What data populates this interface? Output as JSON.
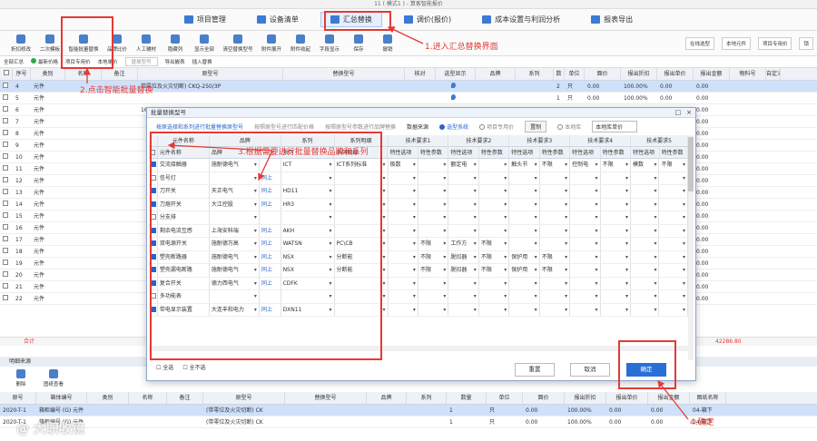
{
  "window": {
    "title": "11 ( 模式1 ) - 算客智能报价"
  },
  "tabs": [
    {
      "label": "项目管理"
    },
    {
      "label": "设备清单"
    },
    {
      "label": "汇总替换"
    },
    {
      "label": "调价(报价)"
    },
    {
      "label": "成本设置与利润分析"
    },
    {
      "label": "报表导出"
    }
  ],
  "toolbar": {
    "items": [
      "折扣修改",
      "二次模板",
      "智能批量替换",
      "品牌比价",
      "人工辅材",
      "隐藏列",
      "显示全部",
      "清空替换型号",
      "附件展开",
      "附件收起",
      "字段显示",
      "保存",
      "撤销"
    ],
    "right": [
      "在线选型",
      "本地元件",
      "项目专用价",
      "锁"
    ]
  },
  "subbar": {
    "items": [
      "全部汇总",
      "最新价格",
      "项目专用价",
      "本地单价",
      "替换型号",
      "导出嵌表",
      "插入替换"
    ]
  },
  "main_grid": {
    "columns": [
      "序号",
      "类别",
      "名称",
      "备注",
      "原型号",
      "替换型号",
      "核对",
      "选型显示",
      "品牌",
      "系列",
      "数",
      "单位",
      "面价",
      "报出折扣",
      "报出单价",
      "报出金额",
      "物料号",
      "自定义"
    ],
    "rows": [
      {
        "no": "4",
        "cat": "元件",
        "orig": "带零位及火灾切断) CKQ-250/3P",
        "qty": "2",
        "unit": "只",
        "price": "0.00",
        "disc": "100.00%",
        "up": "0.00",
        "amt": "0.00"
      },
      {
        "no": "5",
        "cat": "元件",
        "orig": "",
        "qty": "1",
        "unit": "只",
        "price": "0.00",
        "disc": "100.00%",
        "up": "0.00",
        "amt": "0.00"
      },
      {
        "no": "6",
        "cat": "元件",
        "orig": "16A/30mA CKBL-63C/1P+N",
        "qty": "",
        "unit": "",
        "price": "",
        "disc": "",
        "up": "0.00",
        "amt": "0.00"
      },
      {
        "no": "7",
        "cat": "元件",
        "orig": "",
        "qty": "",
        "unit": "",
        "price": "",
        "disc": "",
        "up": "0.00",
        "amt": "0.00"
      },
      {
        "no": "8",
        "cat": "元件",
        "orig": "",
        "qty": "",
        "unit": "",
        "price": "",
        "disc": "",
        "up": "0.00",
        "amt": "0.00"
      },
      {
        "no": "9",
        "cat": "元件",
        "orig": "",
        "qty": "",
        "unit": "",
        "price": "",
        "disc": "",
        "up": "0.00",
        "amt": "0.00"
      },
      {
        "no": "10",
        "cat": "元件",
        "orig": "",
        "qty": "",
        "unit": "",
        "price": "",
        "disc": "",
        "up": "0.00",
        "amt": "0.00"
      },
      {
        "no": "11",
        "cat": "元件",
        "orig": "",
        "qty": "",
        "unit": "",
        "price": "",
        "disc": "",
        "up": "0.00",
        "amt": "0.00"
      },
      {
        "no": "12",
        "cat": "元件",
        "orig": "",
        "qty": "",
        "unit": "",
        "price": "",
        "disc": "",
        "up": "0.00",
        "amt": "0.00"
      },
      {
        "no": "13",
        "cat": "元件",
        "orig": "",
        "qty": "",
        "unit": "",
        "price": "",
        "disc": "",
        "up": "0.00",
        "amt": "0.00"
      },
      {
        "no": "14",
        "cat": "元件",
        "orig": "",
        "qty": "",
        "unit": "",
        "price": "",
        "disc": "",
        "up": "0.00",
        "amt": "0.00"
      },
      {
        "no": "15",
        "cat": "元件",
        "orig": "",
        "qty": "",
        "unit": "",
        "price": "",
        "disc": "",
        "up": "0.00",
        "amt": "0.00"
      },
      {
        "no": "16",
        "cat": "元件",
        "orig": "",
        "qty": "",
        "unit": "",
        "price": "",
        "disc": "",
        "up": "0.00",
        "amt": "0.00"
      },
      {
        "no": "17",
        "cat": "元件",
        "orig": "",
        "qty": "",
        "unit": "",
        "price": "",
        "disc": "",
        "up": "0.00",
        "amt": "0.00"
      },
      {
        "no": "18",
        "cat": "元件",
        "orig": "",
        "qty": "",
        "unit": "",
        "price": "",
        "disc": "",
        "up": "0.00",
        "amt": "0.00"
      },
      {
        "no": "19",
        "cat": "元件",
        "orig": "",
        "qty": "",
        "unit": "",
        "price": "",
        "disc": "",
        "up": "0.00",
        "amt": "0.00"
      },
      {
        "no": "20",
        "cat": "元件",
        "orig": "",
        "qty": "",
        "unit": "",
        "price": "",
        "disc": "",
        "up": "0.00",
        "amt": "0.00"
      },
      {
        "no": "21",
        "cat": "元件",
        "orig": "",
        "qty": "",
        "unit": "",
        "price": "",
        "disc": "",
        "up": "0.00",
        "amt": "0.00"
      },
      {
        "no": "22",
        "cat": "元件",
        "orig": "",
        "qty": "",
        "unit": "",
        "price": "",
        "disc": "",
        "up": "0.00",
        "amt": "0.00"
      }
    ],
    "total_label": "合计",
    "total_value": "42286.80"
  },
  "detail": {
    "title": "明细来源",
    "tools": [
      "删除",
      "图纸查看"
    ],
    "columns": [
      "原号",
      "箱体编号",
      "类别",
      "名称",
      "备注",
      "原型号",
      "替换型号",
      "品牌",
      "系列",
      "数量",
      "单位",
      "面价",
      "报出折扣",
      "报出单价",
      "报出金额",
      "图纸名称"
    ],
    "rows": [
      {
        "no": "2020-T-1",
        "box": "箱柜编号 (G) 元件",
        "orig": "(带零位及火灾切断) CK",
        "qty": "1",
        "unit": "只",
        "price": "0.00",
        "disc": "100.00%",
        "up": "0.00",
        "amt": "0.00",
        "draw": "04-箱下"
      },
      {
        "no": "2020-T-1",
        "box": "箱柜编号 (G) 元件",
        "orig": "(带零位及火灾切断) CK",
        "qty": "1",
        "unit": "只",
        "price": "0.00",
        "disc": "100.00%",
        "up": "0.00",
        "amt": "0.00",
        "draw": "04-箱下"
      }
    ]
  },
  "watermark": "@ 大职收镜",
  "dialog": {
    "title": "批量替换型号",
    "links": [
      "按原选择和系列进行批量替换原型号",
      "按照原型号进行匹配价格",
      "按照原型号参数进行品牌替换"
    ],
    "data_source_label": "数据来源",
    "source_options": [
      "选型系统",
      "项目专用价",
      "本地库"
    ],
    "prefill_button": "置制",
    "local_select": "本地库单价",
    "head1": [
      "元件名称",
      "品牌",
      "系列",
      "系列明细",
      "技术要求1",
      "技术要求2",
      "技术要求3",
      "技术要求4",
      "技术要求5"
    ],
    "head2": [
      "元件名称",
      "品牌",
      "系列",
      "系列明细",
      "特性选项",
      "特性参数",
      "特性选项",
      "特性参数",
      "特性选项",
      "特性参数",
      "特性选项",
      "特性参数",
      "特性选项",
      "特性参数"
    ],
    "rows": [
      {
        "name": "交流接触器",
        "brand": "施耐德电气",
        "up": "",
        "series": "ICT",
        "detail": "ICT系列标准",
        "t1o": "极数",
        "t1p": "",
        "t2o": "额定电",
        "t2p": "",
        "t3o": "触头节",
        "t3p": "不限",
        "t4o": "控制电",
        "t4p": "不限",
        "t5o": "模数",
        "t5p": "不限"
      },
      {
        "name": "信号灯",
        "brand": "",
        "up": "同上",
        "series": "",
        "detail": "",
        "t1o": "",
        "t1p": "",
        "t2o": "",
        "t2p": "",
        "t3o": "",
        "t3p": "",
        "t4o": "",
        "t4p": "",
        "t5o": "",
        "t5p": ""
      },
      {
        "name": "刀开关",
        "brand": "天正电气",
        "up": "同上",
        "series": "HD11",
        "detail": "",
        "t1o": "",
        "t1p": "",
        "t2o": "",
        "t2p": "",
        "t3o": "",
        "t3p": "",
        "t4o": "",
        "t4p": "",
        "t5o": "",
        "t5p": ""
      },
      {
        "name": "刀熔开关",
        "brand": "大江控股",
        "up": "同上",
        "series": "HR3",
        "detail": "",
        "t1o": "",
        "t1p": "",
        "t2o": "",
        "t2p": "",
        "t3o": "",
        "t3p": "",
        "t4o": "",
        "t4p": "",
        "t5o": "",
        "t5p": ""
      },
      {
        "name": "分支排",
        "brand": "",
        "up": "",
        "series": "",
        "detail": "",
        "t1o": "",
        "t1p": "",
        "t2o": "",
        "t2p": "",
        "t3o": "",
        "t3p": "",
        "t4o": "",
        "t4p": "",
        "t5o": "",
        "t5p": ""
      },
      {
        "name": "剩余电流互感",
        "brand": "上海安科瑞",
        "up": "同上",
        "series": "AKH",
        "detail": "",
        "t1o": "",
        "t1p": "",
        "t2o": "",
        "t2p": "",
        "t3o": "",
        "t3p": "",
        "t4o": "",
        "t4p": "",
        "t5o": "",
        "t5p": ""
      },
      {
        "name": "双电源开关",
        "brand": "施耐德万高",
        "up": "同上",
        "series": "WATSN",
        "detail": "PC\\CB",
        "t1o": "",
        "t1p": "不限",
        "t2o": "工作方",
        "t2p": "不限",
        "t3o": "",
        "t3p": "",
        "t4o": "",
        "t4p": "",
        "t5o": "",
        "t5p": ""
      },
      {
        "name": "塑壳断路器",
        "brand": "施耐德电气",
        "up": "同上",
        "series": "NSX",
        "detail": "分断能",
        "t1o": "",
        "t1p": "不限",
        "t2o": "脱扣器",
        "t2p": "不限",
        "t3o": "保护用",
        "t3p": "不限",
        "t4o": "",
        "t4p": "",
        "t5o": "",
        "t5p": ""
      },
      {
        "name": "塑壳漏电断路",
        "brand": "施耐德电气",
        "up": "同上",
        "series": "NSX",
        "detail": "分断能",
        "t1o": "",
        "t1p": "不限",
        "t2o": "脱扣器",
        "t2p": "不限",
        "t3o": "保护用",
        "t3p": "不限",
        "t4o": "",
        "t4p": "",
        "t5o": "",
        "t5p": ""
      },
      {
        "name": "复合开关",
        "brand": "德力西电气",
        "up": "同上",
        "series": "CDFK",
        "detail": "",
        "t1o": "",
        "t1p": "",
        "t2o": "",
        "t2p": "",
        "t3o": "",
        "t3p": "",
        "t4o": "",
        "t4p": "",
        "t5o": "",
        "t5p": ""
      },
      {
        "name": "多功能表",
        "brand": "",
        "up": "",
        "series": "",
        "detail": "",
        "t1o": "",
        "t1p": "",
        "t2o": "",
        "t2p": "",
        "t3o": "",
        "t3p": "",
        "t4o": "",
        "t4p": "",
        "t5o": "",
        "t5p": ""
      },
      {
        "name": "带电显示装置",
        "brand": "大连丰和电力",
        "up": "同上",
        "series": "DXN11",
        "detail": "",
        "t1o": "",
        "t1p": "",
        "t2o": "",
        "t2p": "",
        "t3o": "",
        "t3p": "",
        "t4o": "",
        "t4p": "",
        "t5o": "",
        "t5p": ""
      }
    ],
    "footer": {
      "select_all": "全选",
      "deselect_all": "全不选",
      "reset": "重置",
      "cancel": "取消",
      "ok": "确定"
    }
  },
  "annotations": {
    "step1": "1.进入汇总替换界面",
    "step2": "2.点击智能批量替换",
    "step3": "3.根据需要进行批量替换品牌和系列",
    "step4": "4.确定"
  },
  "colors": {
    "accent": "#2a6fd6",
    "annotation": "#e53935",
    "selected_row": "#cfe0fa"
  }
}
